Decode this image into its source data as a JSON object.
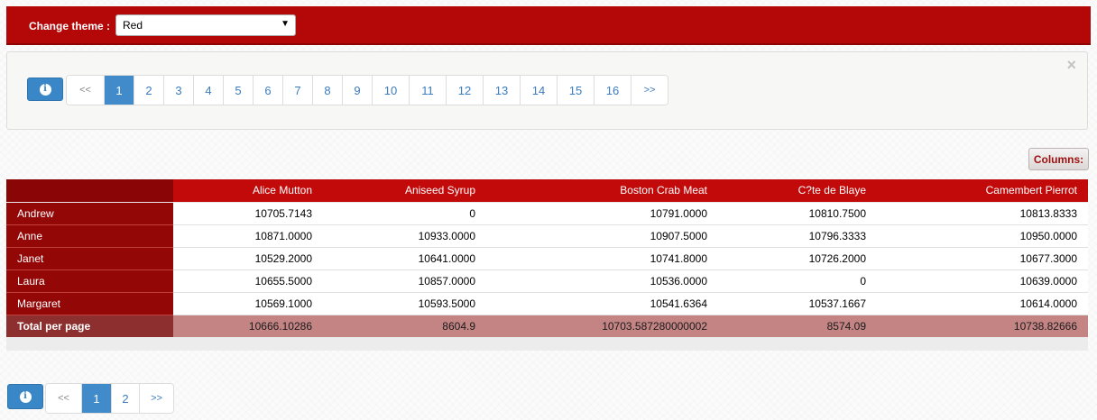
{
  "theme": {
    "label": "Change theme :",
    "selected": "Red"
  },
  "top_pager": {
    "prev": "<<",
    "next": ">>",
    "pages": [
      "1",
      "2",
      "3",
      "4",
      "5",
      "6",
      "7",
      "8",
      "9",
      "10",
      "11",
      "12",
      "13",
      "14",
      "15",
      "16"
    ],
    "active": "1",
    "close": "×"
  },
  "columns_button": "Columns:",
  "table": {
    "columns": [
      "Alice Mutton",
      "Aniseed Syrup",
      "Boston Crab Meat",
      "C?te de Blaye",
      "Camembert Pierrot"
    ],
    "rows": [
      {
        "name": "Andrew",
        "values": [
          "10705.7143",
          "0",
          "10791.0000",
          "10810.7500",
          "10813.8333"
        ]
      },
      {
        "name": "Anne",
        "values": [
          "10871.0000",
          "10933.0000",
          "10907.5000",
          "10796.3333",
          "10950.0000"
        ]
      },
      {
        "name": "Janet",
        "values": [
          "10529.2000",
          "10641.0000",
          "10741.8000",
          "10726.2000",
          "10677.3000"
        ]
      },
      {
        "name": "Laura",
        "values": [
          "10655.5000",
          "10857.0000",
          "10536.0000",
          "0",
          "10639.0000"
        ]
      },
      {
        "name": "Margaret",
        "values": [
          "10569.1000",
          "10593.5000",
          "10541.6364",
          "10537.1667",
          "10614.0000"
        ]
      }
    ],
    "total": {
      "label": "Total per page",
      "values": [
        "10666.10286",
        "8604.9",
        "10703.587280000002",
        "8574.09",
        "10738.82666"
      ]
    }
  },
  "bottom_pager": {
    "prev": "<<",
    "next": ">>",
    "pages": [
      "1",
      "2"
    ],
    "active": "1"
  },
  "colors": {
    "header": "#b40808",
    "table_header": "#c20a0a",
    "row_header": "#930707",
    "total_row": "#c48484",
    "pager_active": "#428bca"
  }
}
